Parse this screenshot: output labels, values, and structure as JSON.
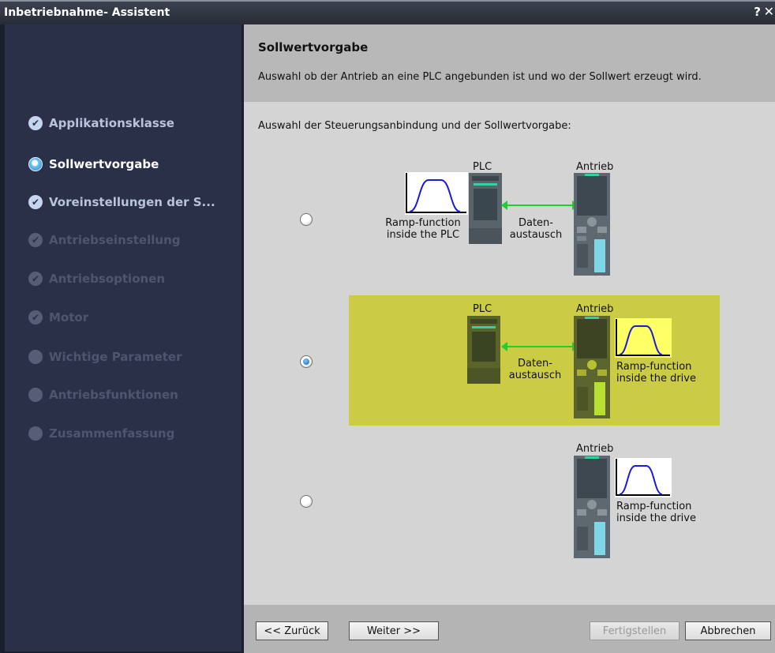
{
  "window": {
    "title": "Inbetriebnahme- Assistent",
    "help_label": "?",
    "close_label": "✕"
  },
  "sidebar": {
    "steps": [
      {
        "label": "Applikationsklasse",
        "state": "done"
      },
      {
        "label": "Sollwertvorgabe",
        "state": "active"
      },
      {
        "label": "Voreinstellungen der S...",
        "state": "done"
      },
      {
        "label": "Antriebseinstellung",
        "state": "disabled"
      },
      {
        "label": "Antriebsoptionen",
        "state": "disabled"
      },
      {
        "label": "Motor",
        "state": "disabled"
      },
      {
        "label": "Wichtige Parameter",
        "state": "disabled"
      },
      {
        "label": "Antriebsfunktionen",
        "state": "disabled"
      },
      {
        "label": "Zusammenfassung",
        "state": "disabled"
      }
    ]
  },
  "header": {
    "title": "Sollwertvorgabe",
    "description": "Auswahl ob der Antrieb an eine PLC angebunden ist und wo der Sollwert erzeugt wird."
  },
  "content": {
    "intro": "Auswahl der Steuerungsanbindung und der Sollwertvorgabe:",
    "options": [
      {
        "selected": false,
        "plc_label": "PLC",
        "drive_label": "Antrieb",
        "ramp_label_line1": "Ramp-function",
        "ramp_label_line2": "inside the PLC",
        "exchange_line1": "Daten-",
        "exchange_line2": "austausch"
      },
      {
        "selected": true,
        "plc_label": "PLC",
        "drive_label": "Antrieb",
        "ramp_label_line1": "Ramp-function",
        "ramp_label_line2": "inside the drive",
        "exchange_line1": "Daten-",
        "exchange_line2": "austausch"
      },
      {
        "selected": false,
        "drive_label": "Antrieb",
        "ramp_label_line1": "Ramp-function",
        "ramp_label_line2": "inside the drive"
      }
    ]
  },
  "footer": {
    "back_label": "<< Zurück",
    "next_label": "Weiter >>",
    "finish_label": "Fertigstellen",
    "cancel_label": "Abbrechen"
  },
  "colors": {
    "sidebar_bg": "#2a3047",
    "highlight": "#cccc44",
    "arrow": "#22cc33",
    "ramp_curve": "#1a1ad8"
  }
}
